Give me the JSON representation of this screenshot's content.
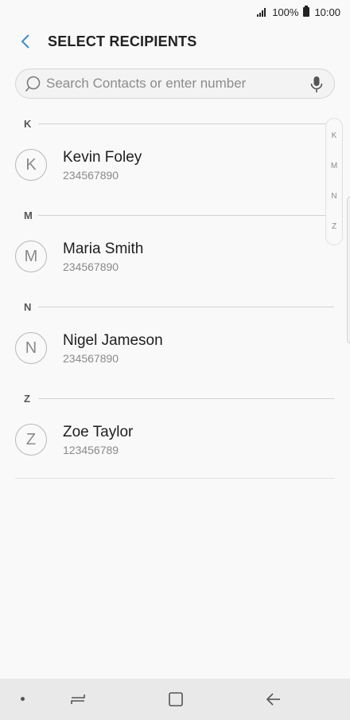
{
  "status_bar": {
    "battery_percent": "100%",
    "time": "10:00"
  },
  "header": {
    "title": "SELECT RECIPIENTS"
  },
  "search": {
    "placeholder": "Search Contacts or enter number",
    "value": ""
  },
  "sections": [
    {
      "letter": "K",
      "contact": {
        "initial": "K",
        "name": "Kevin Foley",
        "number": "234567890"
      }
    },
    {
      "letter": "M",
      "contact": {
        "initial": "M",
        "name": "Maria Smith",
        "number": "234567890"
      }
    },
    {
      "letter": "N",
      "contact": {
        "initial": "N",
        "name": "Nigel Jameson",
        "number": "234567890"
      }
    },
    {
      "letter": "Z",
      "contact": {
        "initial": "Z",
        "name": "Zoe Taylor",
        "number": "123456789"
      }
    }
  ],
  "index_scroller": [
    "K",
    "M",
    "N",
    "Z"
  ],
  "colors": {
    "background": "#f9f9f9",
    "accent_back_arrow": "#3e8fd0",
    "nav_bar": "#e9e9e9",
    "secondary_text": "#8a8a8a"
  },
  "icons": {
    "back": "chevron-left-icon",
    "search": "search-icon",
    "mic": "mic-icon",
    "nav_recents": "recents-icon",
    "nav_home": "home-icon",
    "nav_back": "back-arrow-icon"
  }
}
